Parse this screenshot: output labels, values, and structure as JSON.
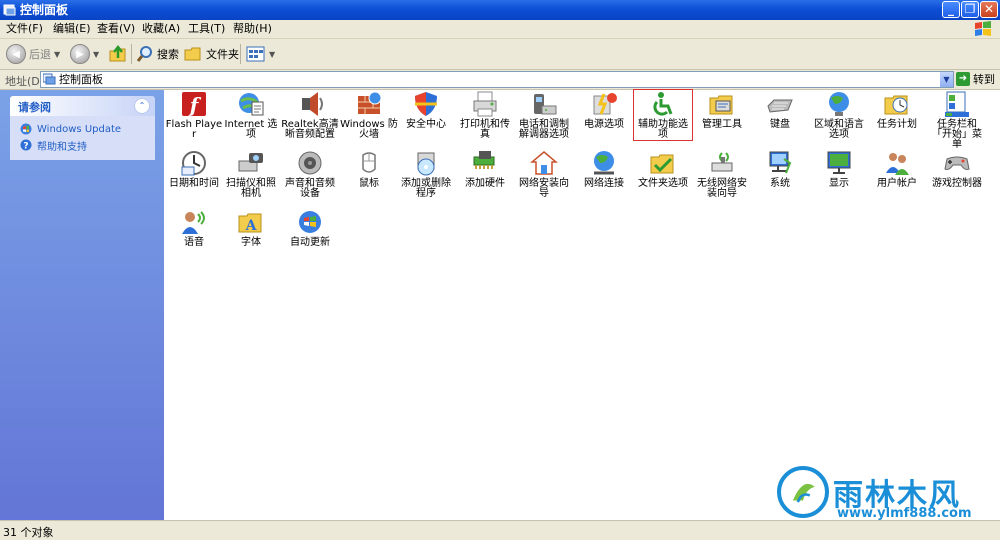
{
  "window": {
    "title": "控制面板"
  },
  "menu": [
    "文件(F)",
    "编辑(E)",
    "查看(V)",
    "收藏(A)",
    "工具(T)",
    "帮助(H)"
  ],
  "toolbar": {
    "back": "后退",
    "search": "搜索",
    "folders": "文件夹"
  },
  "address": {
    "label": "地址(D)",
    "value": "控制面板",
    "go": "转到"
  },
  "sidebar": {
    "title": "请参阅",
    "links": [
      "Windows Update",
      "帮助和支持"
    ]
  },
  "items": [
    {
      "label": "Flash Player",
      "icon": "flash-icon"
    },
    {
      "label": "Internet 选项",
      "icon": "internet-options-icon"
    },
    {
      "label": "Realtek高清晰音频配置",
      "icon": "audio-speaker-icon"
    },
    {
      "label": "Windows 防火墙",
      "icon": "firewall-icon"
    },
    {
      "label": "安全中心",
      "icon": "shield-icon"
    },
    {
      "label": "打印机和传真",
      "icon": "printer-icon"
    },
    {
      "label": "电话和调制解调器选项",
      "icon": "phone-modem-icon"
    },
    {
      "label": "电源选项",
      "icon": "power-icon"
    },
    {
      "label": "辅助功能选项",
      "icon": "accessibility-icon"
    },
    {
      "label": "管理工具",
      "icon": "admin-tools-icon"
    },
    {
      "label": "键盘",
      "icon": "keyboard-icon"
    },
    {
      "label": "区域和语言选项",
      "icon": "globe-icon"
    },
    {
      "label": "任务计划",
      "icon": "scheduled-tasks-icon"
    },
    {
      "label": "任务栏和「开始」菜单",
      "icon": "taskbar-icon"
    },
    {
      "label": "日期和时间",
      "icon": "clock-icon"
    },
    {
      "label": "扫描仪和照相机",
      "icon": "scanner-camera-icon"
    },
    {
      "label": "声音和音频设备",
      "icon": "sound-icon"
    },
    {
      "label": "鼠标",
      "icon": "mouse-icon"
    },
    {
      "label": "添加或删除程序",
      "icon": "add-remove-programs-icon"
    },
    {
      "label": "添加硬件",
      "icon": "add-hardware-icon"
    },
    {
      "label": "网络安装向导",
      "icon": "network-setup-icon"
    },
    {
      "label": "网络连接",
      "icon": "network-connections-icon"
    },
    {
      "label": "文件夹选项",
      "icon": "folder-options-icon"
    },
    {
      "label": "无线网络安装向导",
      "icon": "wireless-icon"
    },
    {
      "label": "系统",
      "icon": "system-icon"
    },
    {
      "label": "显示",
      "icon": "display-icon"
    },
    {
      "label": "用户帐户",
      "icon": "user-accounts-icon"
    },
    {
      "label": "游戏控制器",
      "icon": "game-controller-icon"
    },
    {
      "label": "语音",
      "icon": "speech-icon"
    },
    {
      "label": "字体",
      "icon": "fonts-icon"
    },
    {
      "label": "自动更新",
      "icon": "auto-update-icon"
    }
  ],
  "selected_index": 8,
  "status": "31 个对象",
  "watermark": {
    "title": "雨林木风",
    "url": "www.ylmf888.com"
  }
}
